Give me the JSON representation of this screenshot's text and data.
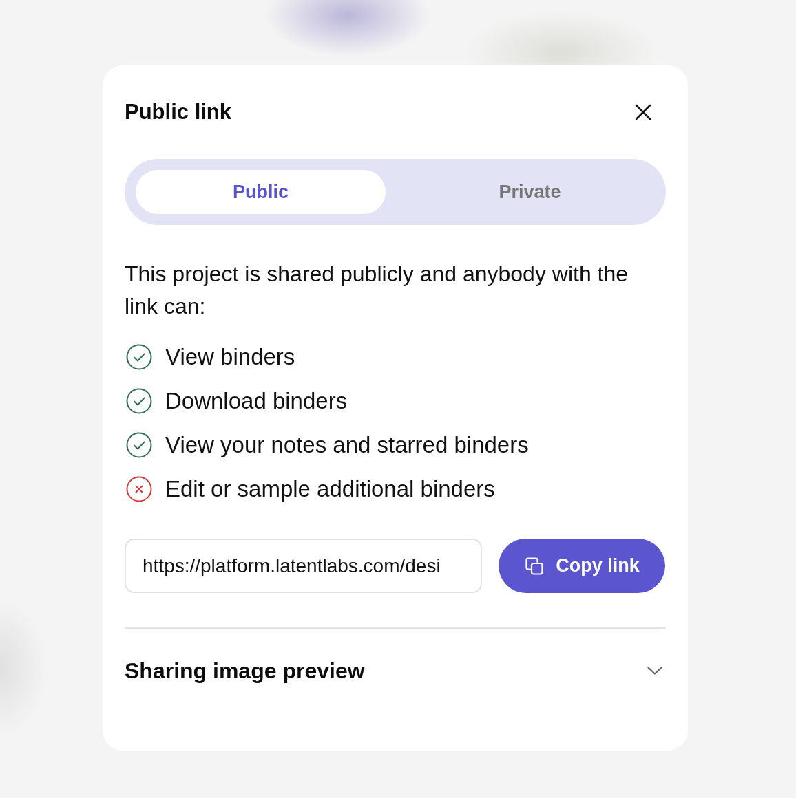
{
  "dialog": {
    "title": "Public link"
  },
  "visibility_tabs": [
    {
      "label": "Public",
      "selected": true
    },
    {
      "label": "Private",
      "selected": false
    }
  ],
  "description": "This project is shared publicly and anybody with the link can:",
  "permissions": [
    {
      "label": "View binders",
      "allowed": true
    },
    {
      "label": "Download binders",
      "allowed": true
    },
    {
      "label": "View your notes and starred binders",
      "allowed": true
    },
    {
      "label": "Edit or sample additional binders",
      "allowed": false
    }
  ],
  "link_field": {
    "value": "https://platform.latentlabs.com/desi"
  },
  "copy_button": {
    "label": "Copy link"
  },
  "accordion": {
    "title": "Sharing image preview",
    "expanded": false
  }
}
